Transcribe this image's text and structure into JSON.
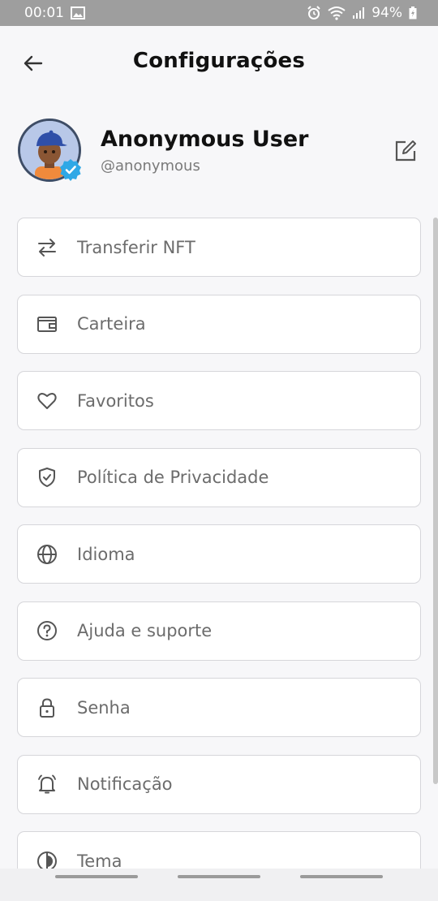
{
  "status_bar": {
    "time": "00:01",
    "battery": "94%"
  },
  "header": {
    "title": "Configurações"
  },
  "profile": {
    "name": "Anonymous User",
    "handle": "@anonymous"
  },
  "menu": {
    "items": [
      {
        "label": "Transferir NFT",
        "icon": "transfer-icon"
      },
      {
        "label": "Carteira",
        "icon": "wallet-icon"
      },
      {
        "label": "Favoritos",
        "icon": "heart-icon"
      },
      {
        "label": "Política de Privacidade",
        "icon": "shield-check-icon"
      },
      {
        "label": "Idioma",
        "icon": "globe-icon"
      },
      {
        "label": "Ajuda e suporte",
        "icon": "help-circle-icon"
      },
      {
        "label": "Senha",
        "icon": "lock-icon"
      },
      {
        "label": "Notificação",
        "icon": "bell-icon"
      },
      {
        "label": "Tema",
        "icon": "theme-icon"
      }
    ]
  },
  "colors": {
    "accent_verified": "#2fa8e6",
    "status_bar": "#9e9e9e",
    "border": "#d6d6da"
  }
}
